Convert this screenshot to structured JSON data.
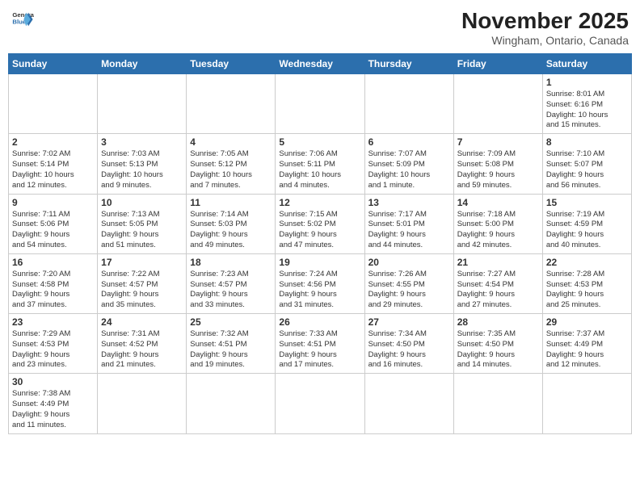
{
  "header": {
    "logo_general": "General",
    "logo_blue": "Blue",
    "month_title": "November 2025",
    "location": "Wingham, Ontario, Canada"
  },
  "days_of_week": [
    "Sunday",
    "Monday",
    "Tuesday",
    "Wednesday",
    "Thursday",
    "Friday",
    "Saturday"
  ],
  "weeks": [
    [
      {
        "day": "",
        "content": ""
      },
      {
        "day": "",
        "content": ""
      },
      {
        "day": "",
        "content": ""
      },
      {
        "day": "",
        "content": ""
      },
      {
        "day": "",
        "content": ""
      },
      {
        "day": "",
        "content": ""
      },
      {
        "day": "1",
        "content": "Sunrise: 8:01 AM\nSunset: 6:16 PM\nDaylight: 10 hours\nand 15 minutes."
      }
    ],
    [
      {
        "day": "2",
        "content": "Sunrise: 7:02 AM\nSunset: 5:14 PM\nDaylight: 10 hours\nand 12 minutes."
      },
      {
        "day": "3",
        "content": "Sunrise: 7:03 AM\nSunset: 5:13 PM\nDaylight: 10 hours\nand 9 minutes."
      },
      {
        "day": "4",
        "content": "Sunrise: 7:05 AM\nSunset: 5:12 PM\nDaylight: 10 hours\nand 7 minutes."
      },
      {
        "day": "5",
        "content": "Sunrise: 7:06 AM\nSunset: 5:11 PM\nDaylight: 10 hours\nand 4 minutes."
      },
      {
        "day": "6",
        "content": "Sunrise: 7:07 AM\nSunset: 5:09 PM\nDaylight: 10 hours\nand 1 minute."
      },
      {
        "day": "7",
        "content": "Sunrise: 7:09 AM\nSunset: 5:08 PM\nDaylight: 9 hours\nand 59 minutes."
      },
      {
        "day": "8",
        "content": "Sunrise: 7:10 AM\nSunset: 5:07 PM\nDaylight: 9 hours\nand 56 minutes."
      }
    ],
    [
      {
        "day": "9",
        "content": "Sunrise: 7:11 AM\nSunset: 5:06 PM\nDaylight: 9 hours\nand 54 minutes."
      },
      {
        "day": "10",
        "content": "Sunrise: 7:13 AM\nSunset: 5:05 PM\nDaylight: 9 hours\nand 51 minutes."
      },
      {
        "day": "11",
        "content": "Sunrise: 7:14 AM\nSunset: 5:03 PM\nDaylight: 9 hours\nand 49 minutes."
      },
      {
        "day": "12",
        "content": "Sunrise: 7:15 AM\nSunset: 5:02 PM\nDaylight: 9 hours\nand 47 minutes."
      },
      {
        "day": "13",
        "content": "Sunrise: 7:17 AM\nSunset: 5:01 PM\nDaylight: 9 hours\nand 44 minutes."
      },
      {
        "day": "14",
        "content": "Sunrise: 7:18 AM\nSunset: 5:00 PM\nDaylight: 9 hours\nand 42 minutes."
      },
      {
        "day": "15",
        "content": "Sunrise: 7:19 AM\nSunset: 4:59 PM\nDaylight: 9 hours\nand 40 minutes."
      }
    ],
    [
      {
        "day": "16",
        "content": "Sunrise: 7:20 AM\nSunset: 4:58 PM\nDaylight: 9 hours\nand 37 minutes."
      },
      {
        "day": "17",
        "content": "Sunrise: 7:22 AM\nSunset: 4:57 PM\nDaylight: 9 hours\nand 35 minutes."
      },
      {
        "day": "18",
        "content": "Sunrise: 7:23 AM\nSunset: 4:57 PM\nDaylight: 9 hours\nand 33 minutes."
      },
      {
        "day": "19",
        "content": "Sunrise: 7:24 AM\nSunset: 4:56 PM\nDaylight: 9 hours\nand 31 minutes."
      },
      {
        "day": "20",
        "content": "Sunrise: 7:26 AM\nSunset: 4:55 PM\nDaylight: 9 hours\nand 29 minutes."
      },
      {
        "day": "21",
        "content": "Sunrise: 7:27 AM\nSunset: 4:54 PM\nDaylight: 9 hours\nand 27 minutes."
      },
      {
        "day": "22",
        "content": "Sunrise: 7:28 AM\nSunset: 4:53 PM\nDaylight: 9 hours\nand 25 minutes."
      }
    ],
    [
      {
        "day": "23",
        "content": "Sunrise: 7:29 AM\nSunset: 4:53 PM\nDaylight: 9 hours\nand 23 minutes."
      },
      {
        "day": "24",
        "content": "Sunrise: 7:31 AM\nSunset: 4:52 PM\nDaylight: 9 hours\nand 21 minutes."
      },
      {
        "day": "25",
        "content": "Sunrise: 7:32 AM\nSunset: 4:51 PM\nDaylight: 9 hours\nand 19 minutes."
      },
      {
        "day": "26",
        "content": "Sunrise: 7:33 AM\nSunset: 4:51 PM\nDaylight: 9 hours\nand 17 minutes."
      },
      {
        "day": "27",
        "content": "Sunrise: 7:34 AM\nSunset: 4:50 PM\nDaylight: 9 hours\nand 16 minutes."
      },
      {
        "day": "28",
        "content": "Sunrise: 7:35 AM\nSunset: 4:50 PM\nDaylight: 9 hours\nand 14 minutes."
      },
      {
        "day": "29",
        "content": "Sunrise: 7:37 AM\nSunset: 4:49 PM\nDaylight: 9 hours\nand 12 minutes."
      }
    ],
    [
      {
        "day": "30",
        "content": "Sunrise: 7:38 AM\nSunset: 4:49 PM\nDaylight: 9 hours\nand 11 minutes."
      },
      {
        "day": "",
        "content": ""
      },
      {
        "day": "",
        "content": ""
      },
      {
        "day": "",
        "content": ""
      },
      {
        "day": "",
        "content": ""
      },
      {
        "day": "",
        "content": ""
      },
      {
        "day": "",
        "content": ""
      }
    ]
  ]
}
